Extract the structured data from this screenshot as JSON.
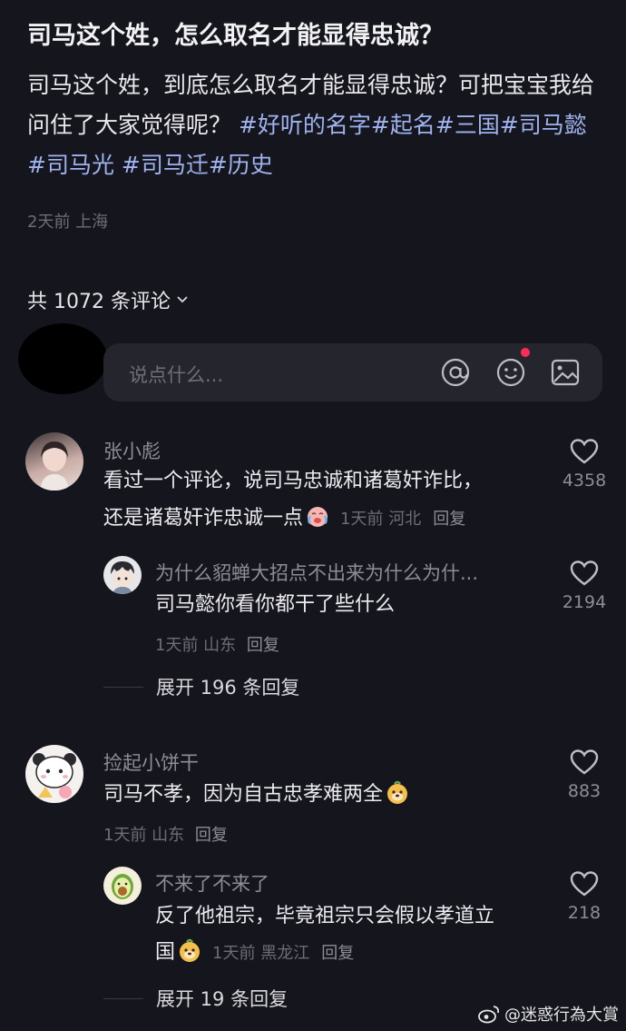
{
  "post": {
    "title": "司马这个姓，怎么取名才能显得忠诚？",
    "body_text": "司马这个姓，到底怎么取名才能显得忠诚？可把宝宝我给问住了大家觉得呢？",
    "tags": [
      "#好听的名字",
      "#起名",
      "#三国",
      "#司马懿",
      "#司马光",
      "#司马迁",
      "#历史"
    ],
    "meta": "2天前 上海"
  },
  "comments_header": {
    "count_label": "共 1072 条评论"
  },
  "input": {
    "placeholder": "说点什么..."
  },
  "comments": [
    {
      "username": "张小彪",
      "text_line1": "看过一个评论，说司马忠诚和诸葛奸诈比，",
      "text_line2": "还是诸葛奸诈忠诚一点",
      "meta": "1天前 河北",
      "reply_label": "回复",
      "likes": "4358",
      "reply": {
        "username": "为什么貂蝉大招点不出来为什么为什...",
        "text": "司马懿你看你都干了些什么",
        "meta": "1天前 山东",
        "reply_label": "回复",
        "likes": "2194"
      },
      "expand_label": "展开 196 条回复"
    },
    {
      "username": "捡起小饼干",
      "text": "司马不孝，因为自古忠孝难两全",
      "meta": "1天前 山东",
      "reply_label": "回复",
      "likes": "883",
      "reply": {
        "username": "不来了不来了",
        "text_line1": "反了他祖宗，毕竟祖宗只会假以孝道立",
        "text_line2": "国",
        "meta": "1天前 黑龙江",
        "reply_label": "回复",
        "likes": "218"
      },
      "expand_label": "展开 19 条回复"
    }
  ],
  "watermark": "@迷惑行為大賞",
  "colors": {
    "background": "#15151d",
    "tag": "#9fb3f0",
    "notification_dot": "#fe2c55"
  }
}
